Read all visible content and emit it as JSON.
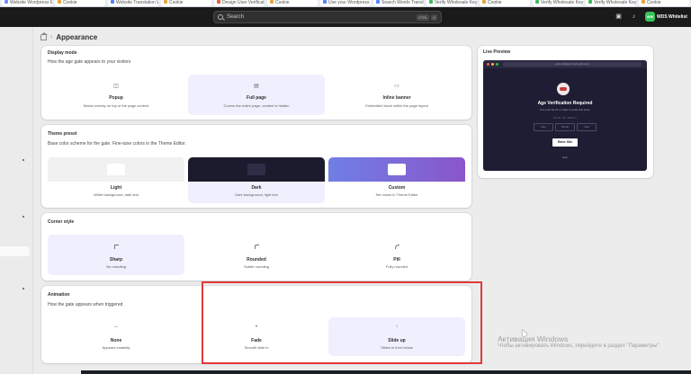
{
  "browser_tabs": [
    {
      "label": "Website Wordpress Editor",
      "color": "#6b8cff"
    },
    {
      "label": "Cookie",
      "color": "#e8a33a"
    },
    {
      "label": "Website Translation With",
      "color": "#4f81ff"
    },
    {
      "label": "Cookie",
      "color": "#e8a33a"
    },
    {
      "label": "Design User Verification",
      "color": "#e85a3a"
    },
    {
      "label": "Cookie",
      "color": "#e8a33a"
    },
    {
      "label": "Use your Wordpress Design",
      "color": "#4f81ff"
    },
    {
      "label": "Search Words Translation",
      "color": "#4f81ff"
    },
    {
      "label": "Verify Wholesale Keywords",
      "color": "#3cb95a"
    },
    {
      "label": "Cookie",
      "color": "#e8a33a"
    },
    {
      "label": "Verify Wholesale Keywords",
      "color": "#3cb95a"
    },
    {
      "label": "Verify Wholesale Keywords",
      "color": "#3cb95a"
    },
    {
      "label": "Cookie",
      "color": "#e8a33a"
    }
  ],
  "topbar": {
    "search_placeholder": "Search",
    "shortcut_ctrl": "CTRL",
    "shortcut_key": "K",
    "store_initials": "WW",
    "store_name": "WDS Whitelist"
  },
  "breadcrumb": {
    "title": "Appearance"
  },
  "display_mode": {
    "title": "Display mode",
    "description": "How the age gate appears to your visitors",
    "options": [
      {
        "icon": "◫",
        "label": "Popup",
        "sub": "Modal overlay on top of the page content",
        "selected": false
      },
      {
        "icon": "▤",
        "label": "Full page",
        "sub": "Covers the entire page, content is hidden",
        "selected": true
      },
      {
        "icon": "▭",
        "label": "Inline banner",
        "sub": "Embedded block within the page layout",
        "selected": false
      }
    ]
  },
  "theme_preset": {
    "title": "Theme preset",
    "description": "Base color scheme for the gate. Fine-tune colors in the Theme Editor.",
    "options": [
      {
        "label": "Light",
        "sub": "White background, dark text",
        "selected": false,
        "swatch_bg": "#f1f1f1",
        "chip_bg": "#ffffff"
      },
      {
        "label": "Dark",
        "sub": "Dark background, light text",
        "selected": true,
        "swatch_bg": "#1c1b2e",
        "chip_bg": "#2e2d45"
      },
      {
        "label": "Custom",
        "sub": "Set colors in Theme Editor",
        "selected": false,
        "swatch_bg": "linear-gradient(90deg,#6f7fe6,#8a56c9)",
        "chip_bg": "#ffffff"
      }
    ]
  },
  "corner_style": {
    "title": "Corner style",
    "options": [
      {
        "label": "Sharp",
        "sub": "No rounding",
        "selected": true,
        "radius": "0"
      },
      {
        "label": "Rounded",
        "sub": "Subtle rounding",
        "selected": false,
        "radius": "2px"
      },
      {
        "label": "Pill",
        "sub": "Fully rounded",
        "selected": false,
        "radius": "4px"
      }
    ]
  },
  "animation": {
    "title": "Animation",
    "description": "How the gate appears when triggered",
    "options": [
      {
        "icon": "–",
        "label": "None",
        "sub": "Appears instantly",
        "selected": false
      },
      {
        "icon": "•",
        "label": "Fade",
        "sub": "Smooth fade in",
        "selected": false
      },
      {
        "icon": "↑",
        "label": "Slide up",
        "sub": "Slides in from below",
        "selected": true
      }
    ]
  },
  "live_preview": {
    "title": "Live Preview",
    "url": "wds-whitelist.myshopify.com",
    "heading": "Age Verification Required",
    "subtext": "You must be 21 or older to enter this store.",
    "dob_label": "DATE OF BIRTH",
    "fields": [
      "Day",
      "Month",
      "Year"
    ],
    "enter_label": "Enter Site",
    "exit_label": "Exit"
  },
  "watermark": {
    "line1": "Активация Windows",
    "line2": "Чтобы активировать Windows, перейдите в раздел \"Параметры\"."
  },
  "colors": {
    "topbar_bg": "#1a1a1a",
    "selected_option_bg": "#f0effd",
    "highlight_box": "#e03a3a",
    "store_avatar": "#36c35c"
  }
}
